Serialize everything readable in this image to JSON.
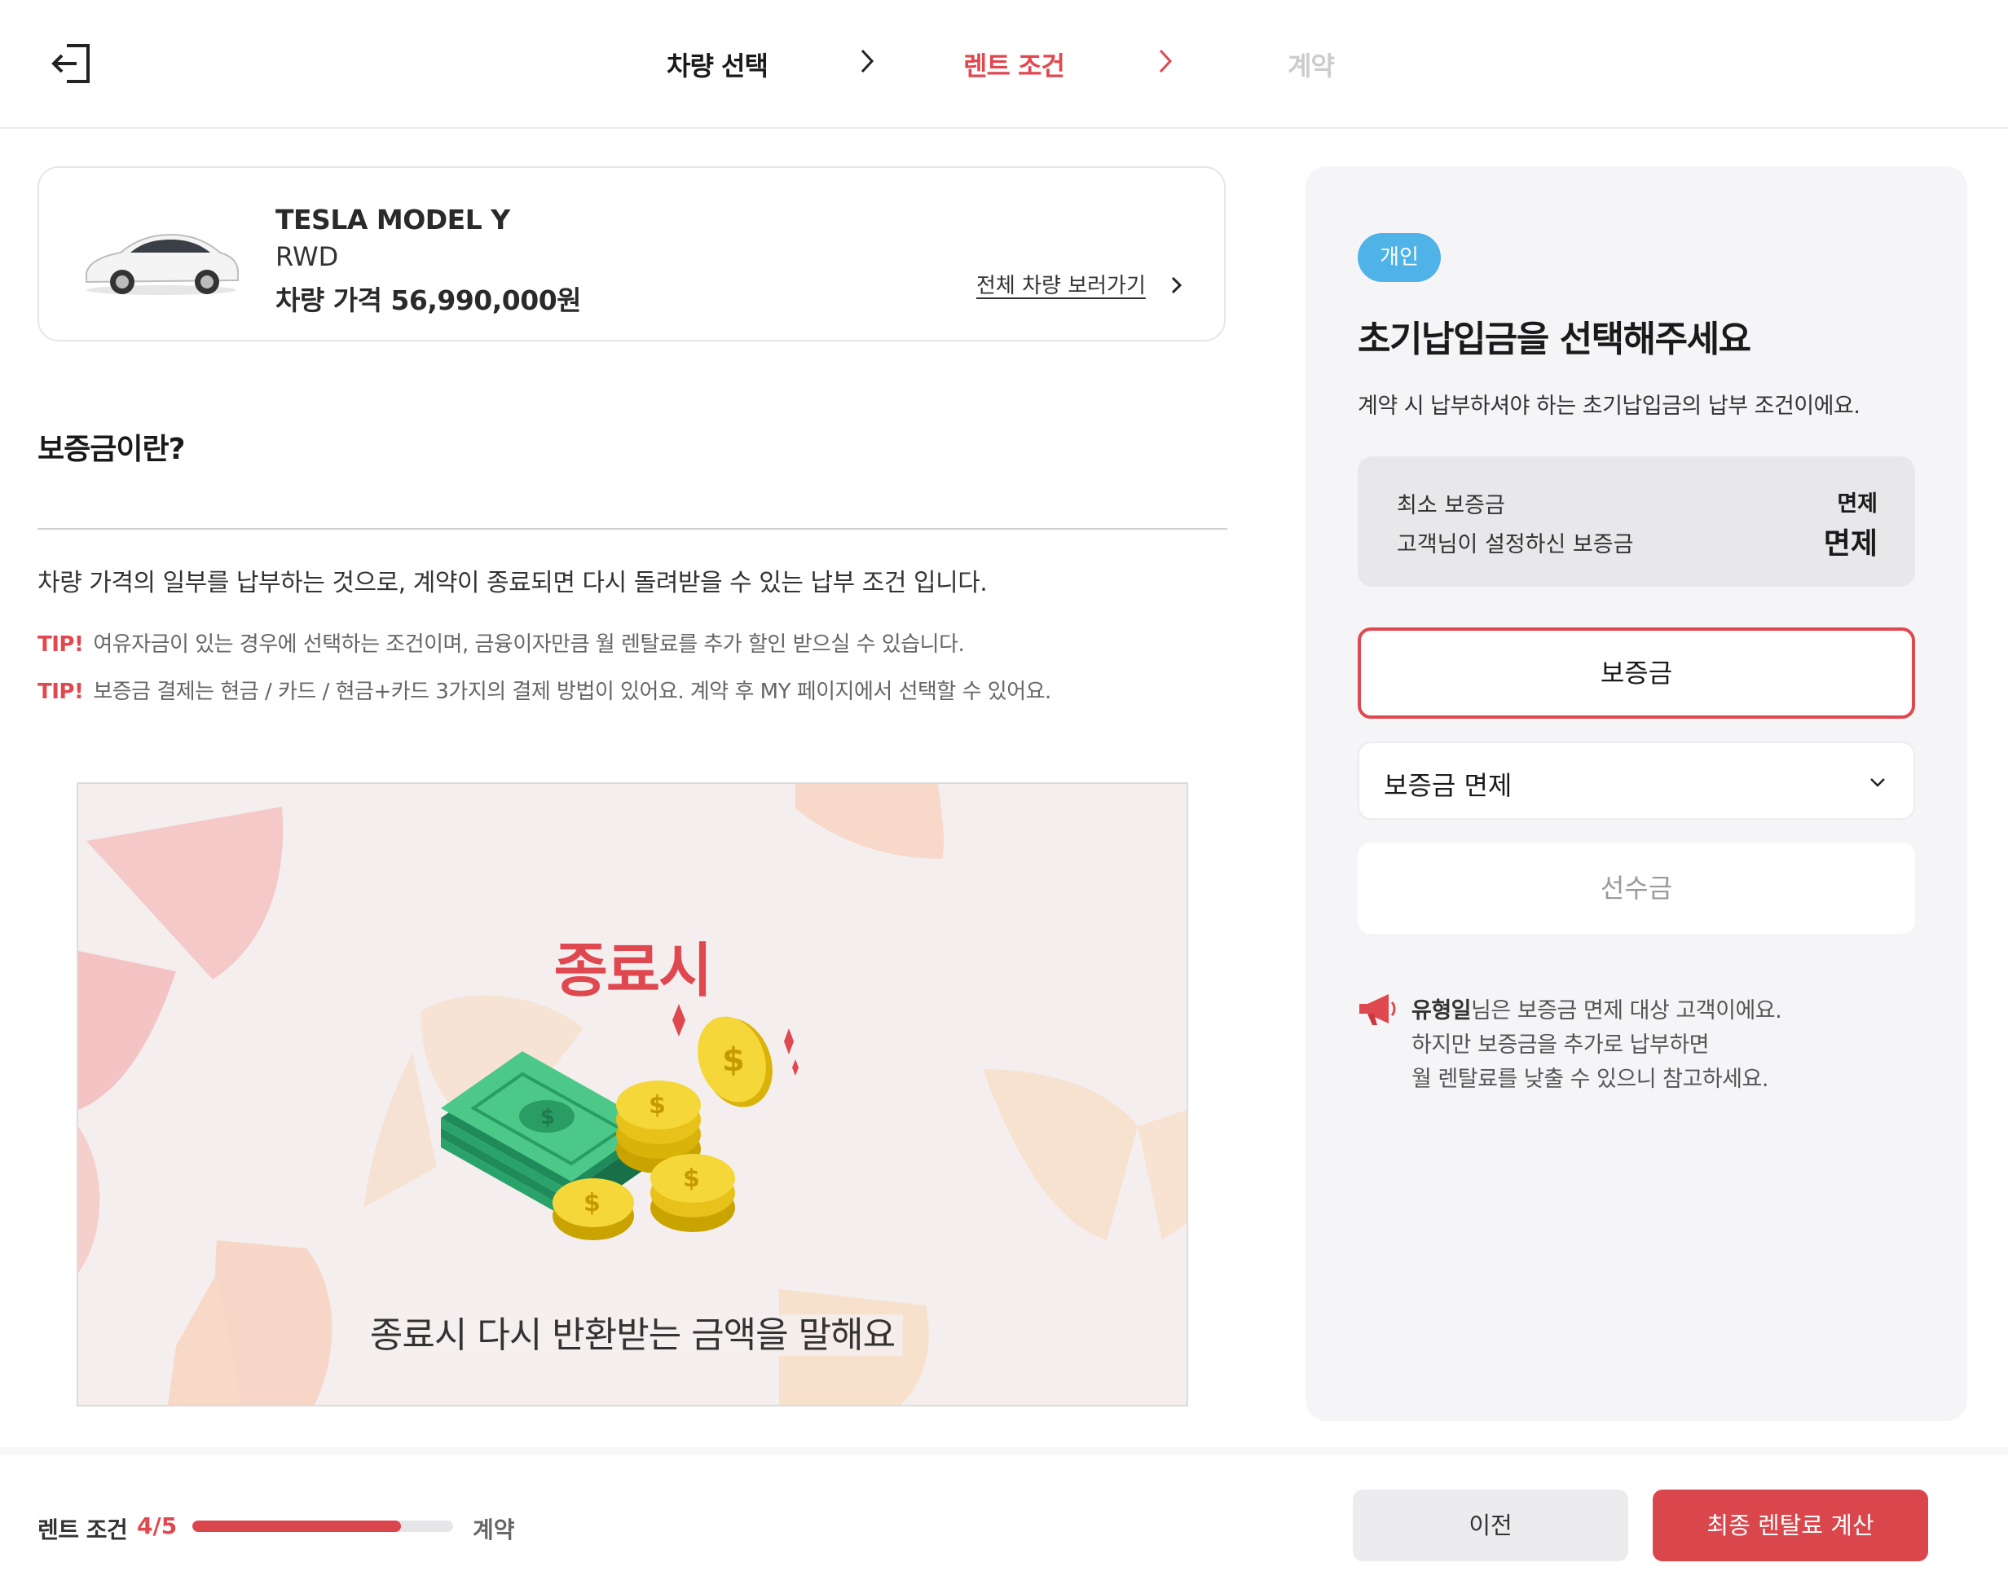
{
  "header": {
    "back_icon": "exit-icon",
    "steps": [
      {
        "label": "차량 선택",
        "state": "done"
      },
      {
        "label": "렌트 조건",
        "state": "active"
      },
      {
        "label": "계약",
        "state": "upcoming"
      }
    ]
  },
  "car": {
    "name": "TESLA MODEL Y",
    "trim": "RWD",
    "price_label": "차량 가격 56,990,000원",
    "view_all_label": "전체 차량 보러가기"
  },
  "info": {
    "title": "보증금이란?",
    "description": "차량 가격의 일부를 납부하는 것으로, 계약이 종료되면 다시 돌려받을 수 있는 납부 조건 입니다.",
    "tips": [
      {
        "label": "TIP!",
        "text": "여유자금이 있는 경우에 선택하는 조건이며, 금융이자만큼 월 렌탈료를 추가 할인 받으실 수 있습니다."
      },
      {
        "label": "TIP!",
        "text": "보증금 결제는 현금 / 카드 / 현금+카드 3가지의 결제 방법이 있어요. 계약 후 MY 페이지에서 선택할 수 있어요."
      }
    ]
  },
  "illustration": {
    "title": "종료시",
    "caption": "종료시 다시 반환받는 금액을 말해요"
  },
  "panel": {
    "badge": "개인",
    "title": "초기납입금을 선택해주세요",
    "description": "계약 시 납부하셔야 하는 초기납입금의 납부 조건이에요.",
    "summary": {
      "min_label": "최소 보증금",
      "min_value": "면제",
      "set_label": "고객님이 설정하신 보증금",
      "set_value": "면제"
    },
    "options": {
      "deposit": "보증금",
      "deposit_select": "보증금 면제",
      "prepayment": "선수금"
    },
    "notice": {
      "name": "유형일",
      "line1": "님은 보증금 면제 대상 고객이에요.",
      "line2": "하지만 보증금을 추가로 납부하면",
      "line3": "월 렌탈료를 낮출 수 있으니 참고하세요."
    }
  },
  "footer": {
    "progress_label": "렌트 조건",
    "progress_count": "4/5",
    "progress_fraction": 0.8,
    "next_step": "계약",
    "prev_button": "이전",
    "calc_button": "최종 렌탈료 계산"
  },
  "colors": {
    "accent": "#e0484f",
    "badge": "#4fb3e8",
    "panel_bg": "#f5f5f7"
  }
}
